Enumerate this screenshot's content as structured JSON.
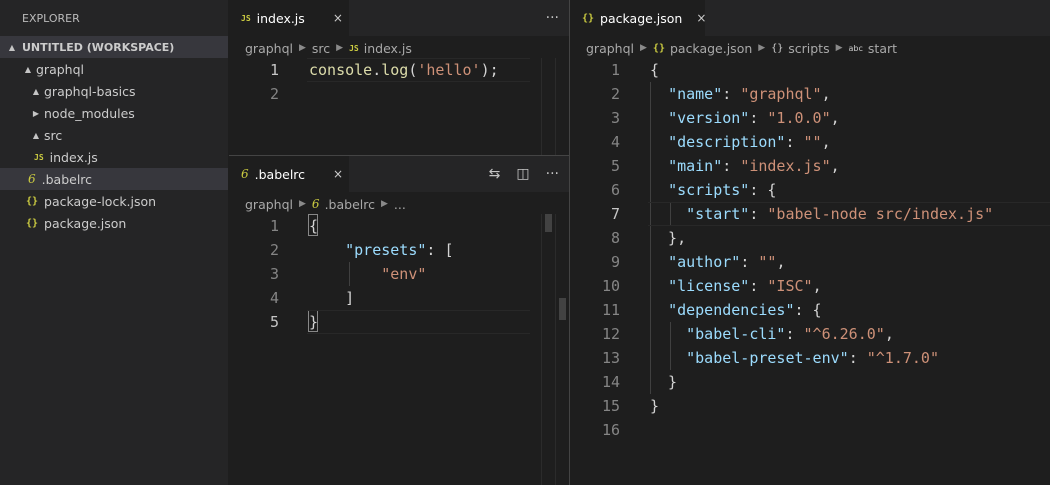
{
  "sidebar": {
    "title": "EXPLORER",
    "workspace": "UNTITLED (WORKSPACE)",
    "tree": [
      {
        "label": "graphql",
        "twisty": "▲",
        "icon": ""
      },
      {
        "label": "graphql-basics",
        "twisty": "▲",
        "icon": ""
      },
      {
        "label": "node_modules",
        "twisty": "▶",
        "icon": ""
      },
      {
        "label": "src",
        "twisty": "▲",
        "icon": ""
      },
      {
        "label": "index.js",
        "twisty": "",
        "icon": "JS"
      },
      {
        "label": ".babelrc",
        "twisty": "",
        "icon": "6",
        "selected": true
      },
      {
        "label": "package-lock.json",
        "twisty": "",
        "icon": "{}"
      },
      {
        "label": "package.json",
        "twisty": "",
        "icon": "{}"
      }
    ]
  },
  "editors": {
    "index_js": {
      "tab": {
        "icon": "JS",
        "label": "index.js",
        "close": "×"
      },
      "actions": {
        "more": "···"
      },
      "breadcrumb": [
        "graphql",
        "src",
        "index.js"
      ],
      "lines": [
        {
          "num": "1",
          "tokens": [
            [
              "fn",
              "console"
            ],
            [
              "p",
              "."
            ],
            [
              "fn",
              "log"
            ],
            [
              "p",
              "("
            ],
            [
              "s",
              "'hello'"
            ],
            [
              "p",
              ");"
            ]
          ]
        },
        {
          "num": "2",
          "tokens": []
        }
      ]
    },
    "babelrc": {
      "tab": {
        "icon": "6",
        "label": ".babelrc",
        "close": "×"
      },
      "actions": {
        "compare": "⇆",
        "split": "◫",
        "more": "···"
      },
      "breadcrumb": [
        "graphql",
        ".babelrc",
        "..."
      ],
      "lines": [
        {
          "num": "1",
          "tokens": [
            [
              "p",
              "{"
            ]
          ]
        },
        {
          "num": "2",
          "tokens": [
            [
              "p",
              "    "
            ],
            [
              "k",
              "\"presets\""
            ],
            [
              "p",
              ": ["
            ]
          ]
        },
        {
          "num": "3",
          "tokens": [
            [
              "p",
              "        "
            ],
            [
              "s",
              "\"env\""
            ]
          ]
        },
        {
          "num": "4",
          "tokens": [
            [
              "p",
              "    ]"
            ]
          ]
        },
        {
          "num": "5",
          "tokens": [
            [
              "p",
              "}"
            ]
          ]
        }
      ]
    },
    "package_json": {
      "tab": {
        "icon": "{}",
        "label": "package.json",
        "close": "×"
      },
      "breadcrumb": [
        "graphql",
        "package.json",
        "scripts",
        "start"
      ],
      "breadcrumb_icons": [
        "",
        "{}",
        "{}",
        "abc"
      ],
      "lines": [
        {
          "num": "1",
          "tokens": [
            [
              "p",
              "{"
            ]
          ]
        },
        {
          "num": "2",
          "tokens": [
            [
              "p",
              "  "
            ],
            [
              "k",
              "\"name\""
            ],
            [
              "p",
              ": "
            ],
            [
              "s",
              "\"graphql\""
            ],
            [
              "p",
              ","
            ]
          ]
        },
        {
          "num": "3",
          "tokens": [
            [
              "p",
              "  "
            ],
            [
              "k",
              "\"version\""
            ],
            [
              "p",
              ": "
            ],
            [
              "s",
              "\"1.0.0\""
            ],
            [
              "p",
              ","
            ]
          ]
        },
        {
          "num": "4",
          "tokens": [
            [
              "p",
              "  "
            ],
            [
              "k",
              "\"description\""
            ],
            [
              "p",
              ": "
            ],
            [
              "s",
              "\"\""
            ],
            [
              "p",
              ","
            ]
          ]
        },
        {
          "num": "5",
          "tokens": [
            [
              "p",
              "  "
            ],
            [
              "k",
              "\"main\""
            ],
            [
              "p",
              ": "
            ],
            [
              "s",
              "\"index.js\""
            ],
            [
              "p",
              ","
            ]
          ]
        },
        {
          "num": "6",
          "tokens": [
            [
              "p",
              "  "
            ],
            [
              "k",
              "\"scripts\""
            ],
            [
              "p",
              ": {"
            ]
          ]
        },
        {
          "num": "7",
          "tokens": [
            [
              "p",
              "    "
            ],
            [
              "k",
              "\"start\""
            ],
            [
              "p",
              ": "
            ],
            [
              "s",
              "\"babel-node src/index.js\""
            ]
          ]
        },
        {
          "num": "8",
          "tokens": [
            [
              "p",
              "  },"
            ]
          ]
        },
        {
          "num": "9",
          "tokens": [
            [
              "p",
              "  "
            ],
            [
              "k",
              "\"author\""
            ],
            [
              "p",
              ": "
            ],
            [
              "s",
              "\"\""
            ],
            [
              "p",
              ","
            ]
          ]
        },
        {
          "num": "10",
          "tokens": [
            [
              "p",
              "  "
            ],
            [
              "k",
              "\"license\""
            ],
            [
              "p",
              ": "
            ],
            [
              "s",
              "\"ISC\""
            ],
            [
              "p",
              ","
            ]
          ]
        },
        {
          "num": "11",
          "tokens": [
            [
              "p",
              "  "
            ],
            [
              "k",
              "\"dependencies\""
            ],
            [
              "p",
              ": {"
            ]
          ]
        },
        {
          "num": "12",
          "tokens": [
            [
              "p",
              "    "
            ],
            [
              "k",
              "\"babel-cli\""
            ],
            [
              "p",
              ": "
            ],
            [
              "s",
              "\"^6.26.0\""
            ],
            [
              "p",
              ","
            ]
          ]
        },
        {
          "num": "13",
          "tokens": [
            [
              "p",
              "    "
            ],
            [
              "k",
              "\"babel-preset-env\""
            ],
            [
              "p",
              ": "
            ],
            [
              "s",
              "\"^1.7.0\""
            ]
          ]
        },
        {
          "num": "14",
          "tokens": [
            [
              "p",
              "  }"
            ]
          ]
        },
        {
          "num": "15",
          "tokens": [
            [
              "p",
              "}"
            ]
          ]
        },
        {
          "num": "16",
          "tokens": []
        }
      ]
    }
  }
}
